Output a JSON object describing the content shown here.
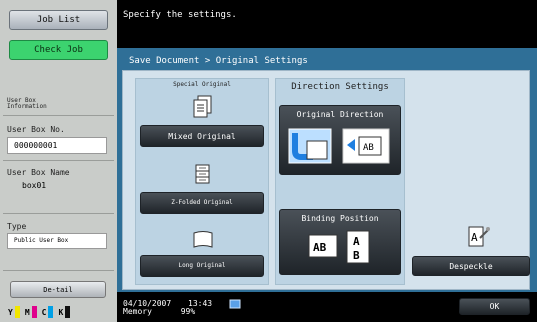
{
  "sidebar": {
    "job_list": "Job List",
    "check_job": "Check Job",
    "user_box_info": "User Box Information",
    "user_box_no_label": "User Box No.",
    "user_box_no": "000000001",
    "user_box_name_label": "User Box Name",
    "user_box_name": "box01",
    "type_label": "Type",
    "type_value": "Public User Box",
    "detail": "De-tail",
    "toner": [
      "Y",
      "M",
      "C",
      "K"
    ],
    "toner_colors": [
      "#f2e600",
      "#e0008c",
      "#00a0e6",
      "#111111"
    ]
  },
  "message": "Specify the settings.",
  "breadcrumb": "Save Document > Original Settings",
  "special_original": {
    "title": "Special Original",
    "mixed": "Mixed Original",
    "zfolded": "Z-Folded Original",
    "long": "Long Original"
  },
  "direction": {
    "title": "Direction Settings",
    "original_direction": "Original Direction",
    "binding_position": "Binding Position"
  },
  "despeckle": "Despeckle",
  "ok": "OK",
  "status": {
    "date": "04/10/2007",
    "time": "13:43",
    "memory_label": "Memory",
    "memory": "99%"
  }
}
